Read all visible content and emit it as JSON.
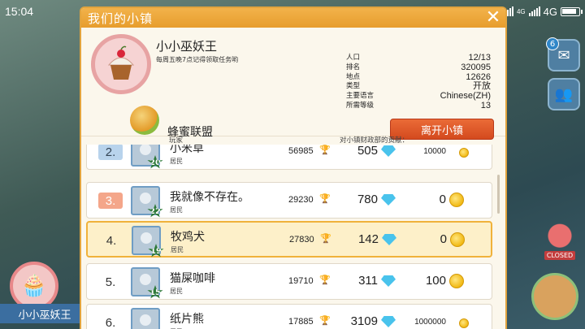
{
  "status_bar": {
    "time": "15:04",
    "network": "4G",
    "network_small": "4G"
  },
  "background": {
    "left_town_name": "小小巫妖王",
    "badge_count": "6",
    "closed_label": "CLOSED"
  },
  "dialog": {
    "title": "我们的小镇",
    "town": {
      "name": "小小巫妖王",
      "motto": "每周五晚7点记得领取任务哟",
      "league": "蜂蜜联盟"
    },
    "stats": [
      {
        "label": "人口",
        "value": "12/13"
      },
      {
        "label": "排名",
        "value": "320095"
      },
      {
        "label": "地点",
        "value": "12626"
      },
      {
        "label": "类型",
        "value": "开放"
      },
      {
        "label": "主要语言",
        "value": "Chinese(ZH)"
      },
      {
        "label": "所需等级",
        "value": "13"
      }
    ],
    "leave_button": "离开小镇",
    "columns": {
      "player": "玩家",
      "contribution": "对小镇财政部的贡献："
    },
    "members": [
      {
        "rank": "2.",
        "level": "20",
        "name": "小米草",
        "role": "居民",
        "score": "56985",
        "gems": "505",
        "coins": "10000"
      },
      {
        "rank": "3.",
        "level": "22",
        "name": "我就像不存在。",
        "role": "居民",
        "score": "29230",
        "gems": "780",
        "coins": "0"
      },
      {
        "rank": "4.",
        "level": "19",
        "name": "牧鸡犬",
        "role": "居民",
        "score": "27830",
        "gems": "142",
        "coins": "0"
      },
      {
        "rank": "5.",
        "level": "15",
        "name": "猫屎咖啡",
        "role": "居民",
        "score": "19710",
        "gems": "311",
        "coins": "100"
      },
      {
        "rank": "6.",
        "level": "",
        "name": "纸片熊",
        "role": "居民",
        "score": "17885",
        "gems": "3109",
        "coins": "1000000"
      }
    ]
  },
  "colors": {
    "accent": "#e79d2d",
    "leave": "#d44a1e",
    "selected_row": "#fdf0c9"
  }
}
